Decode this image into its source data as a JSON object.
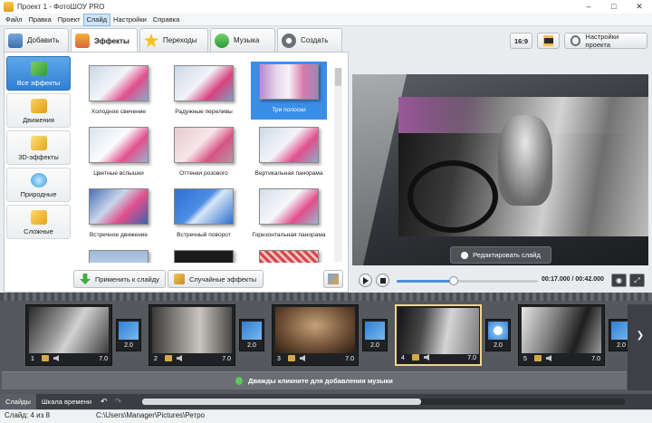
{
  "window": {
    "title": "Проект 1 - ФотоШОУ PRO"
  },
  "menu": [
    "Файл",
    "Правка",
    "Проект",
    "Слайд",
    "Настройки",
    "Справка"
  ],
  "menu_active": "Слайд",
  "tabs": [
    {
      "label": "Добавить",
      "icon": "photos-icon"
    },
    {
      "label": "Эффекты",
      "icon": "palette-icon",
      "active": true
    },
    {
      "label": "Переходы",
      "icon": "star-icon"
    },
    {
      "label": "Музыка",
      "icon": "music-note-icon"
    },
    {
      "label": "Создать",
      "icon": "film-reel-icon"
    }
  ],
  "categories": [
    {
      "label": "Все эффекты",
      "active": true
    },
    {
      "label": "Движения"
    },
    {
      "label": "3D-эффекты"
    },
    {
      "label": "Природные"
    },
    {
      "label": "Сложные"
    }
  ],
  "effects": [
    {
      "label": "Холодное свечение"
    },
    {
      "label": "Радужные переливы"
    },
    {
      "label": "Три полоски",
      "selected": true
    },
    {
      "label": "Цветные вспышки"
    },
    {
      "label": "Оттенки розового"
    },
    {
      "label": "Вертикальная панорама"
    },
    {
      "label": "Встречное движение"
    },
    {
      "label": "Встречный поворот"
    },
    {
      "label": "Горизонтальная панорама"
    },
    {
      "label": ""
    },
    {
      "label": ""
    },
    {
      "label": ""
    }
  ],
  "buttons": {
    "apply": "Применить к слайду",
    "random": "Случайные эффекты",
    "ratio": "16:9",
    "settings": "Настройки проекта",
    "edit_slide": "Редактировать слайд"
  },
  "player": {
    "timecode": "00:17.000 / 00:42.000",
    "progress": 0.4
  },
  "slides": [
    {
      "num": "1",
      "duration": "7.0"
    },
    {
      "num": "2",
      "duration": "7.0"
    },
    {
      "num": "3",
      "duration": "7.0"
    },
    {
      "num": "4",
      "duration": "7.0",
      "current": true
    },
    {
      "num": "5",
      "duration": "7.0"
    }
  ],
  "transitions": [
    "2.0",
    "2.0",
    "2.0",
    "2.0",
    "2.0"
  ],
  "music_hint": "Дважды кликните для добавления музыки",
  "bottom_tabs": [
    {
      "label": "Слайды",
      "active": true
    },
    {
      "label": "Шкала времени"
    }
  ],
  "status": {
    "slide": "Слайд: 4 из 8",
    "path": "C:\\Users\\Manager\\Pictures\\Ретро"
  },
  "colors": {
    "accent": "#3b8ee6",
    "timeline": "#55585d",
    "selected_slide_border": "#f0d48a"
  }
}
